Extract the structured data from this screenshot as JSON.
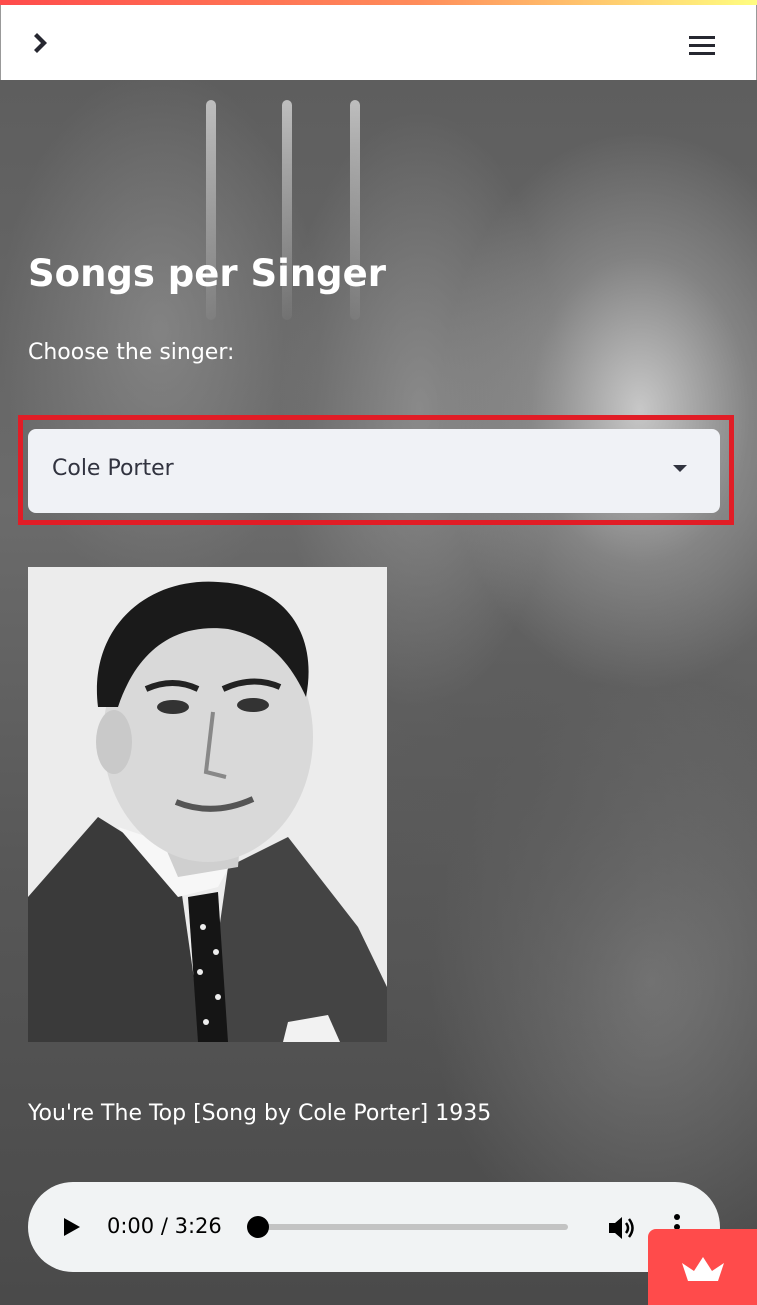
{
  "header": {
    "expand_icon": "chevron-right-icon",
    "menu_icon": "hamburger-menu-icon"
  },
  "main": {
    "title": "Songs per Singer",
    "select_label": "Choose the singer:",
    "select_value": "Cole Porter",
    "song_title": "You're The Top [Song by Cole Porter] 1935"
  },
  "audio_player": {
    "time": "0:00 / 3:26",
    "progress": 0.0
  },
  "colors": {
    "accent": "#ff4b4b",
    "highlight_box": "#e11d26",
    "select_bg": "#f0f2f6",
    "text_dark": "#31333f"
  }
}
